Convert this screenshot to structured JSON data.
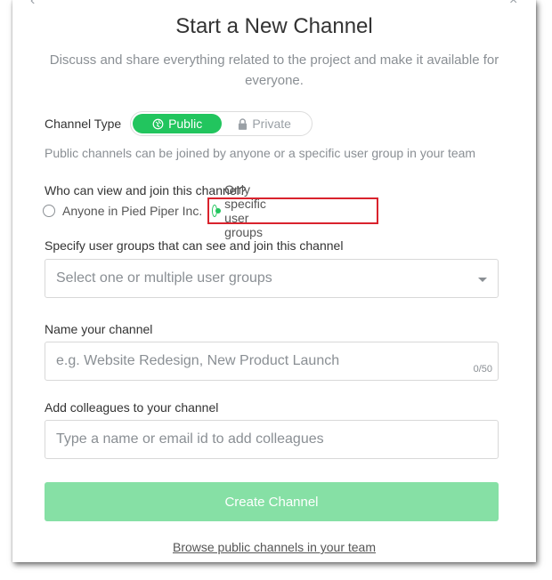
{
  "header": {
    "title": "Start a New Channel",
    "subtitle": "Discuss and share everything related to the project and make it available for everyone."
  },
  "channel_type": {
    "label": "Channel Type",
    "options": [
      {
        "label": "Public",
        "icon": "globe-icon",
        "selected": true
      },
      {
        "label": "Private",
        "icon": "lock-icon",
        "selected": false
      }
    ],
    "help_text": "Public channels can be joined by anyone or a specific user group in your team"
  },
  "visibility": {
    "label": "Who can view and join this channel?",
    "options": [
      {
        "label": "Anyone in Pied Piper Inc.",
        "selected": false
      },
      {
        "label": "Only specific user groups",
        "selected": true
      }
    ]
  },
  "user_groups": {
    "label": "Specify user groups that can see and join this channel",
    "placeholder": "Select one or multiple user groups"
  },
  "channel_name": {
    "label": "Name your channel",
    "placeholder": "e.g. Website Redesign, New Product Launch",
    "counter": "0/50"
  },
  "colleagues": {
    "label": "Add colleagues to your channel",
    "placeholder": "Type a name or email id to add colleagues"
  },
  "actions": {
    "create_label": "Create Channel",
    "browse_label": "Browse public channels in your team"
  },
  "colors": {
    "accent": "#22c55e",
    "button_disabled": "#86e0a5",
    "highlight": "#d9232d"
  }
}
